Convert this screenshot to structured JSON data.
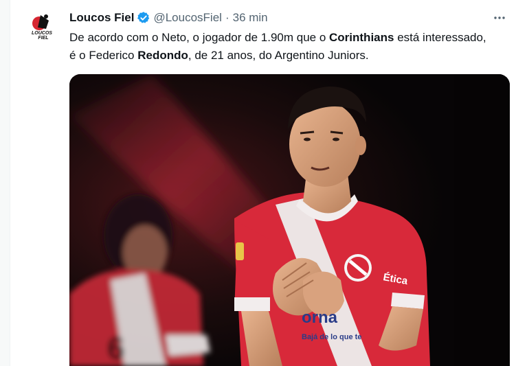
{
  "tweet": {
    "display_name": "Loucos Fiel",
    "handle": "@LoucosFiel",
    "separator": "·",
    "time": "36 min",
    "more_icon": "more-horizontal-icon",
    "verified_icon": "verified-badge-icon",
    "verified_color": "#1d9bf0",
    "avatar_text_top": "LOUCOS",
    "avatar_text_bottom": "FIEL",
    "text_parts": [
      "De acordo com o Neto, o jogador de 1.90m que o ",
      "Corinthians",
      " está interessado, é o Federico ",
      "Redondo",
      ", de 21 anos, do Argentino Juniors."
    ],
    "media": {
      "jersey_sponsor_right": "Ética",
      "jersey_sponsor_front": "orna",
      "jersey_sponsor_small": "Bajá de lo que te"
    }
  },
  "colors": {
    "text_primary": "#0f1419",
    "text_secondary": "#536471",
    "jersey_red": "#d8293a"
  }
}
